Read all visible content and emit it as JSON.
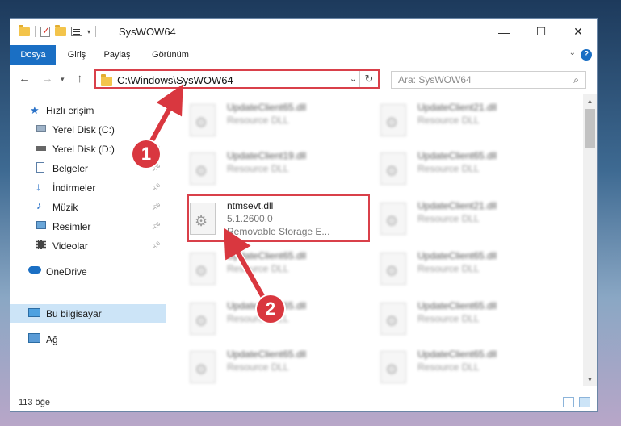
{
  "window": {
    "title": "SysWOW64"
  },
  "ribbon": {
    "tabs": [
      "Dosya",
      "Giriş",
      "Paylaş",
      "Görünüm"
    ]
  },
  "address": {
    "path": "C:\\Windows\\SysWOW64"
  },
  "search": {
    "placeholder": "Ara: SysWOW64"
  },
  "sidebar": {
    "items": [
      {
        "label": "Hızlı erişim"
      },
      {
        "label": "Yerel Disk (C:)"
      },
      {
        "label": "Yerel Disk (D:)"
      },
      {
        "label": "Belgeler"
      },
      {
        "label": "İndirmeler"
      },
      {
        "label": "Müzik"
      },
      {
        "label": "Resimler"
      },
      {
        "label": "Videolar"
      },
      {
        "label": "OneDrive"
      },
      {
        "label": "Bu bilgisayar"
      },
      {
        "label": "Ağ"
      }
    ]
  },
  "files": [
    {
      "name": "UpdateClient65.dll",
      "type": "Resource DLL"
    },
    {
      "name": "UpdateClient21.dll",
      "type": "Resource DLL"
    },
    {
      "name": "UpdateClient19.dll",
      "type": "Resource DLL"
    },
    {
      "name": "UpdateClient65.dll",
      "type": "Resource DLL"
    },
    {
      "name": "ntmsevt.dll",
      "version": "5.1.2600.0",
      "type": "Removable Storage E..."
    },
    {
      "name": "UpdateClient21.dll",
      "type": "Resource DLL"
    },
    {
      "name": "UpdateClient65.dll",
      "type": "Resource DLL"
    },
    {
      "name": "UpdateClient65.dll",
      "type": "Resource DLL"
    },
    {
      "name": "UpdateClient65.dll",
      "type": "Resource DLL"
    },
    {
      "name": "UpdateClient65.dll",
      "type": "Resource DLL"
    },
    {
      "name": "UpdateClient65.dll",
      "type": "Resource DLL"
    },
    {
      "name": "UpdateClient65.dll",
      "type": "Resource DLL"
    }
  ],
  "status": {
    "count": "113 öğe"
  },
  "callouts": [
    "1",
    "2"
  ],
  "colors": {
    "accent": "#1a6fc4",
    "annotation": "#d9373f",
    "selection": "#cce4f7"
  }
}
